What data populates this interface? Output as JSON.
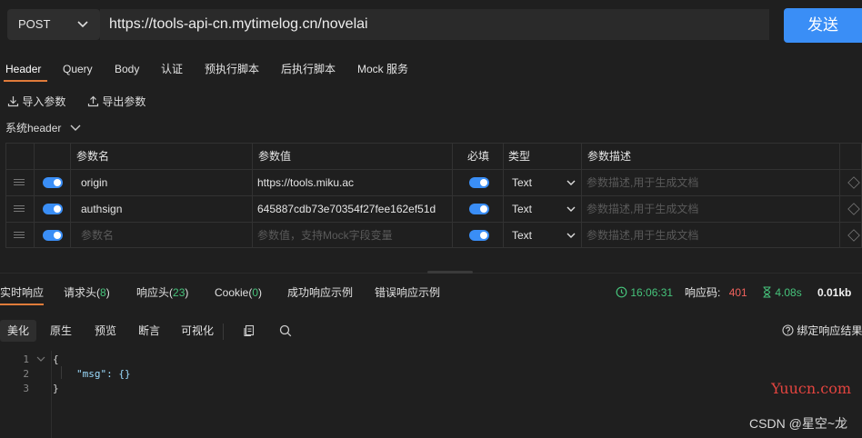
{
  "request": {
    "method": "POST",
    "url": "https://tools-api-cn.mytimelog.cn/novelai",
    "send_label": "发送"
  },
  "tabs": [
    "Header",
    "Query",
    "Body",
    "认证",
    "预执行脚本",
    "后执行脚本",
    "Mock 服务"
  ],
  "actions": {
    "import": "导入参数",
    "export": "导出参数"
  },
  "system_header": "系统header",
  "table": {
    "headers": {
      "name": "参数名",
      "value": "参数值",
      "required": "必填",
      "type": "类型",
      "desc": "参数描述"
    },
    "rows": [
      {
        "name": "origin",
        "value": "https://tools.miku.ac",
        "type": "Text",
        "desc": "参数描述,用于生成文档"
      },
      {
        "name": "authsign",
        "value": "645887cdb73e70354f27fee162ef51d",
        "type": "Text",
        "desc": "参数描述,用于生成文档"
      },
      {
        "name": "参数名",
        "value": "参数值，支持Mock字段变量",
        "type": "Text",
        "desc": "参数描述,用于生成文档"
      }
    ]
  },
  "response": {
    "tabs": {
      "realtime": "实时响应",
      "req_headers": "请求头",
      "req_headers_count": "8",
      "resp_headers": "响应头",
      "resp_headers_count": "23",
      "cookie": "Cookie",
      "cookie_count": "0",
      "success_example": "成功响应示例",
      "error_example": "错误响应示例"
    },
    "time": "16:06:31",
    "status_label": "响应码:",
    "status_code": "401",
    "duration": "4.08s",
    "size": "0.01kb",
    "view_modes": [
      "美化",
      "原生",
      "预览",
      "断言",
      "可视化"
    ],
    "bind_label": "绑定响应结果",
    "code_lines": [
      "{",
      "\"msg\": {}",
      "}"
    ]
  },
  "watermark": {
    "site": "Yuucn.com",
    "author": "CSDN @星空~龙"
  },
  "colors": {
    "accent": "#3a8ef6",
    "tab_active": "#e07b3a",
    "success": "#46c37b",
    "error": "#f0625d"
  }
}
